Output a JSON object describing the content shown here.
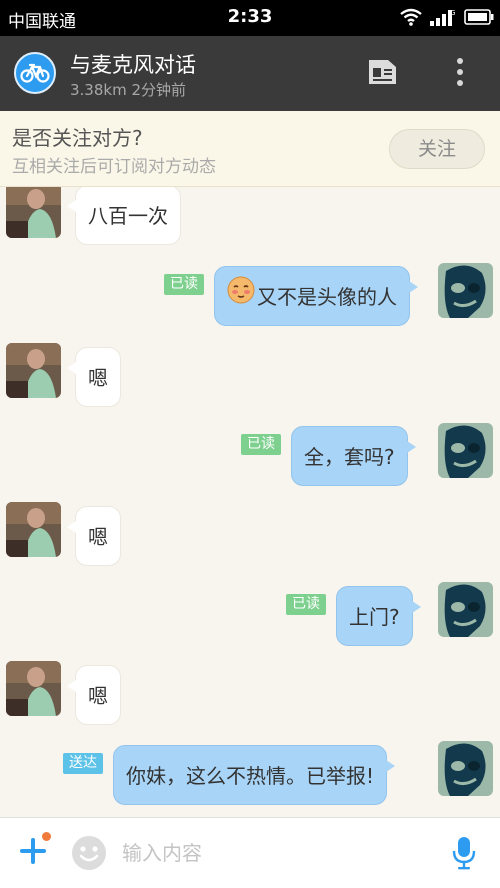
{
  "status_bar": {
    "carrier": "中国联通",
    "time": "2:33"
  },
  "header": {
    "title": "与麦克风对话",
    "subtitle": "3.38km 2分钟前",
    "avatar_icon": "bicycle-icon",
    "actions": [
      "profile-card-icon",
      "more-icon"
    ]
  },
  "follow_banner": {
    "question": "是否关注对方?",
    "description": "互相关注后可订阅对方动态",
    "button_label": "关注"
  },
  "messages": [
    {
      "from": "other",
      "text": "八百一次"
    },
    {
      "from": "me",
      "status": "已读",
      "emoji": "blushing-face-icon",
      "text": "又不是头像的人"
    },
    {
      "from": "other",
      "text": "嗯"
    },
    {
      "from": "me",
      "status": "已读",
      "text": "全，套吗?"
    },
    {
      "from": "other",
      "text": "嗯"
    },
    {
      "from": "me",
      "status": "已读",
      "text": "上门?"
    },
    {
      "from": "other",
      "text": "嗯"
    },
    {
      "from": "me",
      "status": "送达",
      "text": "你妹，这么不热情。已举报!"
    }
  ],
  "input": {
    "placeholder": "输入内容",
    "value": ""
  },
  "colors": {
    "sent_bubble": "#a8d4f7",
    "read_badge": "#7ed08f",
    "delivered_badge": "#5cc2e8",
    "accent_blue": "#2d9cf0",
    "header_bg": "#3a3a3a"
  }
}
